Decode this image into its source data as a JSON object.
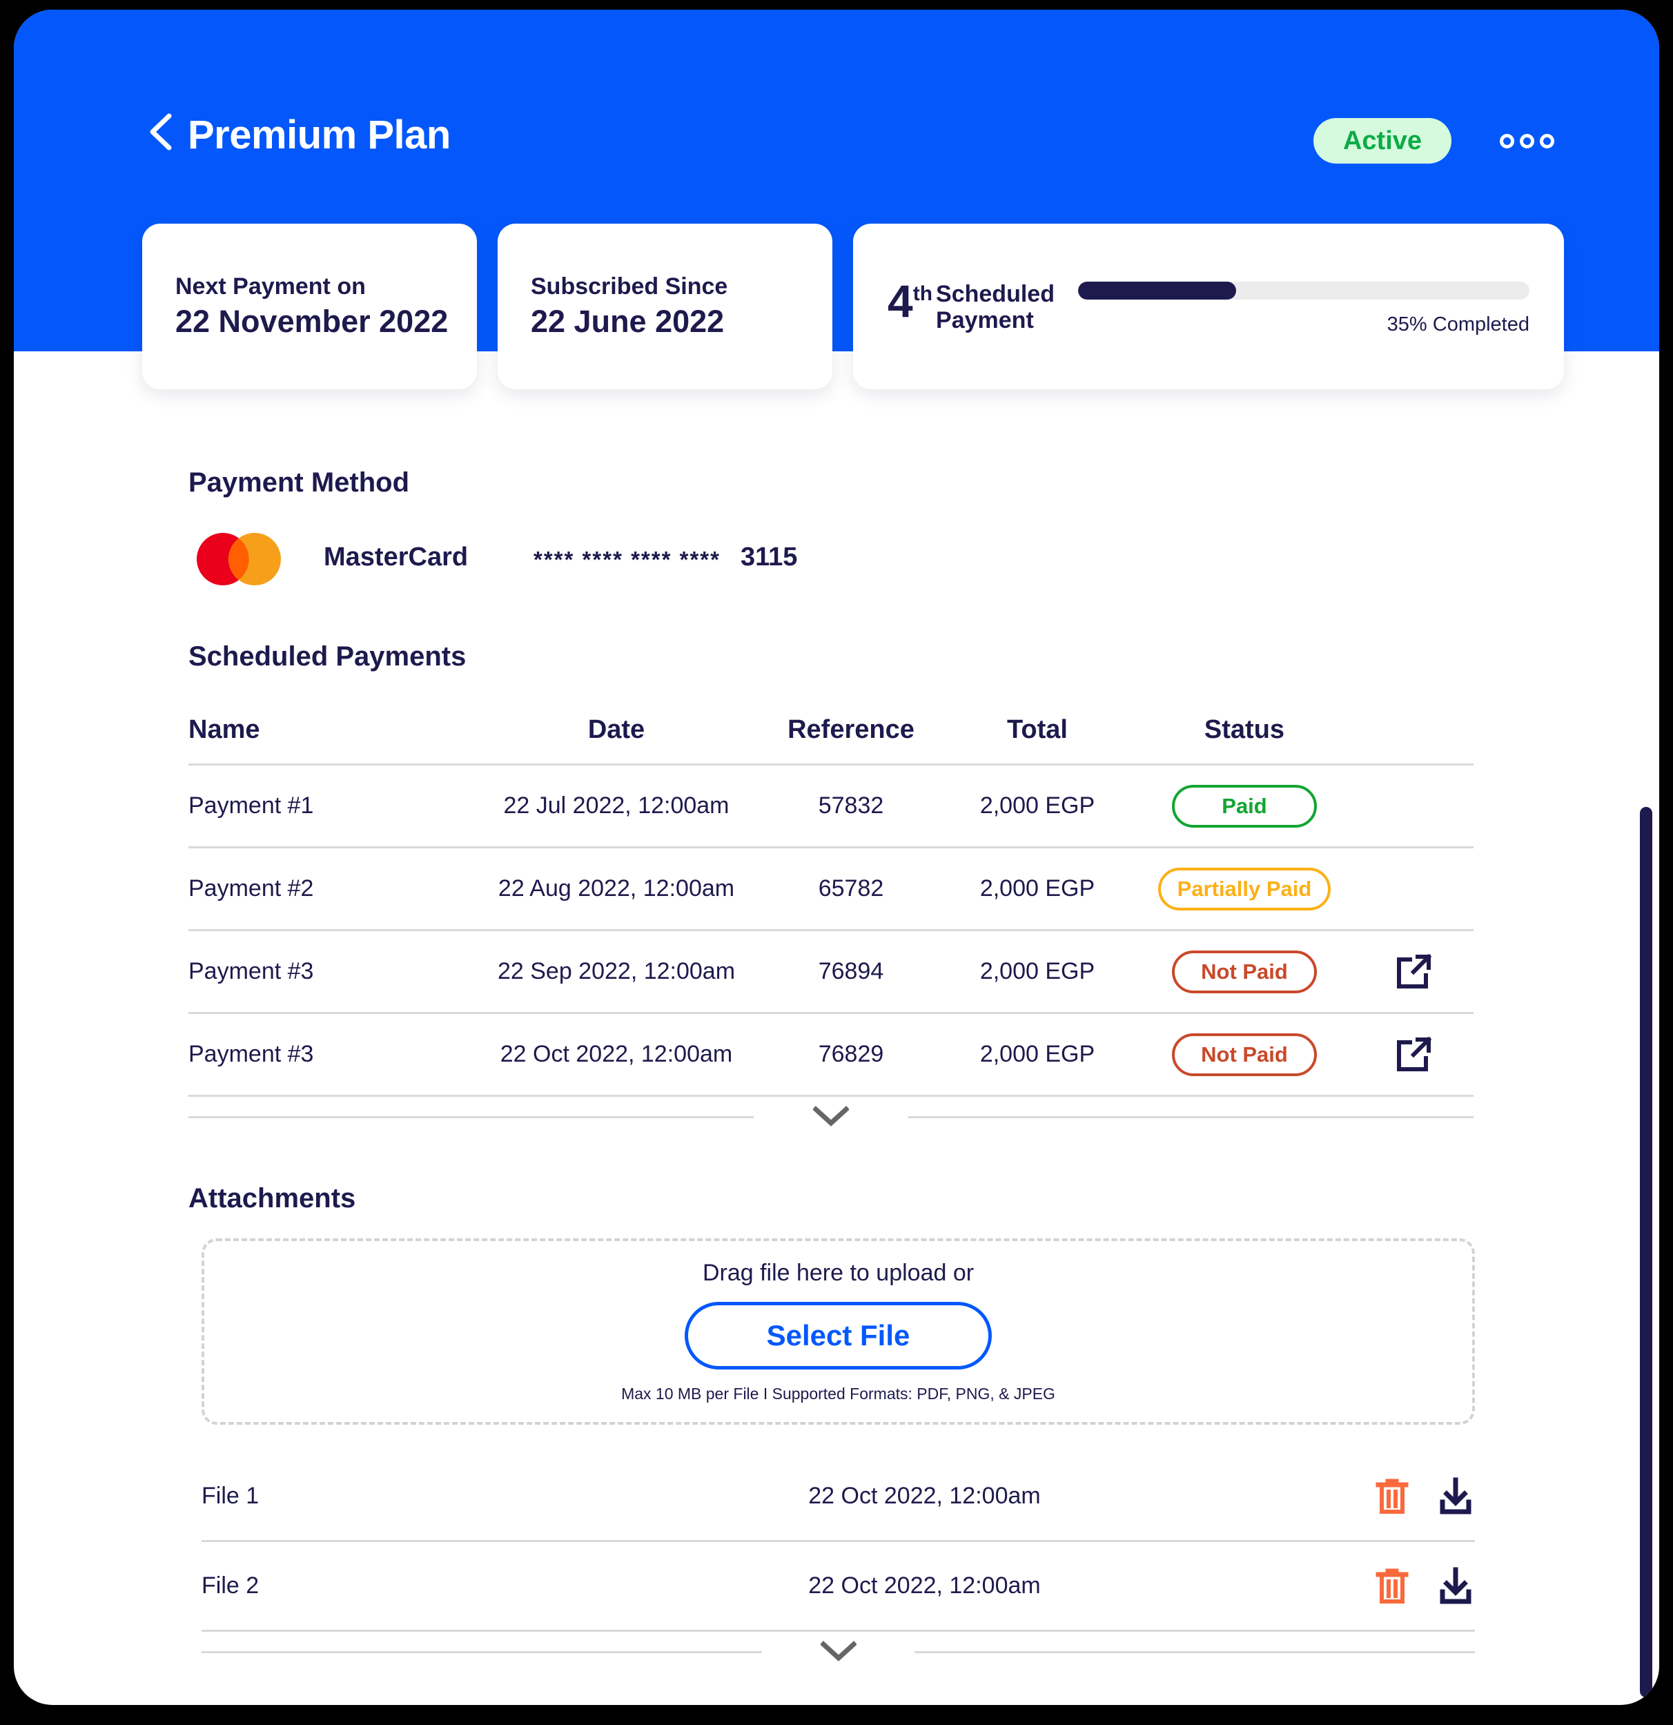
{
  "header": {
    "back_icon": "chevron-left-icon",
    "title": "Premium Plan",
    "status_badge": "Active",
    "more_icon": "more-options-icon",
    "bg_color": "#0458fb",
    "badge_bg": "#d6fade",
    "badge_text_color": "#0caa45"
  },
  "cards": {
    "next_payment": {
      "label": "Next Payment on",
      "value": "22 November 2022"
    },
    "subscribed_since": {
      "label": "Subscribed Since",
      "value": "22 June 2022"
    },
    "scheduled": {
      "number": "4",
      "ordinal": "th",
      "words_line1": "Scheduled",
      "words_line2": "Payment",
      "progress_percent": 35,
      "progress_label": "35% Completed",
      "progress_fill_color": "#1e1a4d",
      "progress_track_color": "#ececec"
    }
  },
  "payment_method": {
    "title": "Payment Method",
    "card_brand": "MasterCard",
    "masked_number": "**** **** **** ****",
    "last4": "3115",
    "logo_icon": "mastercard-logo-icon"
  },
  "scheduled_payments": {
    "title": "Scheduled Payments",
    "columns": [
      "Name",
      "Date",
      "Reference",
      "Total",
      "Status"
    ],
    "rows": [
      {
        "name": "Payment #1",
        "date": "22 Jul 2022, 12:00am",
        "reference": "57832",
        "total": "2,000 EGP",
        "status": "Paid",
        "status_color": "#12a533",
        "has_action": false
      },
      {
        "name": "Payment #2",
        "date": "22 Aug 2022, 12:00am",
        "reference": "65782",
        "total": "2,000 EGP",
        "status": "Partially Paid",
        "status_color": "#fcb017",
        "has_action": false
      },
      {
        "name": "Payment #3",
        "date": "22 Sep 2022, 12:00am",
        "reference": "76894",
        "total": "2,000 EGP",
        "status": "Not Paid",
        "status_color": "#c9492a",
        "has_action": true
      },
      {
        "name": "Payment #3",
        "date": "22 Oct 2022, 12:00am",
        "reference": "76829",
        "total": "2,000 EGP",
        "status": "Not Paid",
        "status_color": "#c9492a",
        "has_action": true
      }
    ],
    "expander_icon": "chevron-down-icon"
  },
  "attachments": {
    "title": "Attachments",
    "dropzone_text": "Drag file here to upload or",
    "select_file_label": "Select File",
    "hint": "Max 10 MB per File  I  Supported Formats: PDF, PNG, & JPEG",
    "accent_color": "#0458fb",
    "files": [
      {
        "name": "File 1",
        "date": "22 Oct 2022, 12:00am"
      },
      {
        "name": "File 2",
        "date": "22 Oct 2022, 12:00am"
      }
    ],
    "delete_icon": "trash-icon",
    "download_icon": "download-icon",
    "delete_icon_color": "#f96a3c",
    "download_icon_color": "#1e1a4d",
    "expander_icon": "chevron-down-icon"
  },
  "scrollbar": {
    "thumb_color": "#1e1a4d"
  }
}
